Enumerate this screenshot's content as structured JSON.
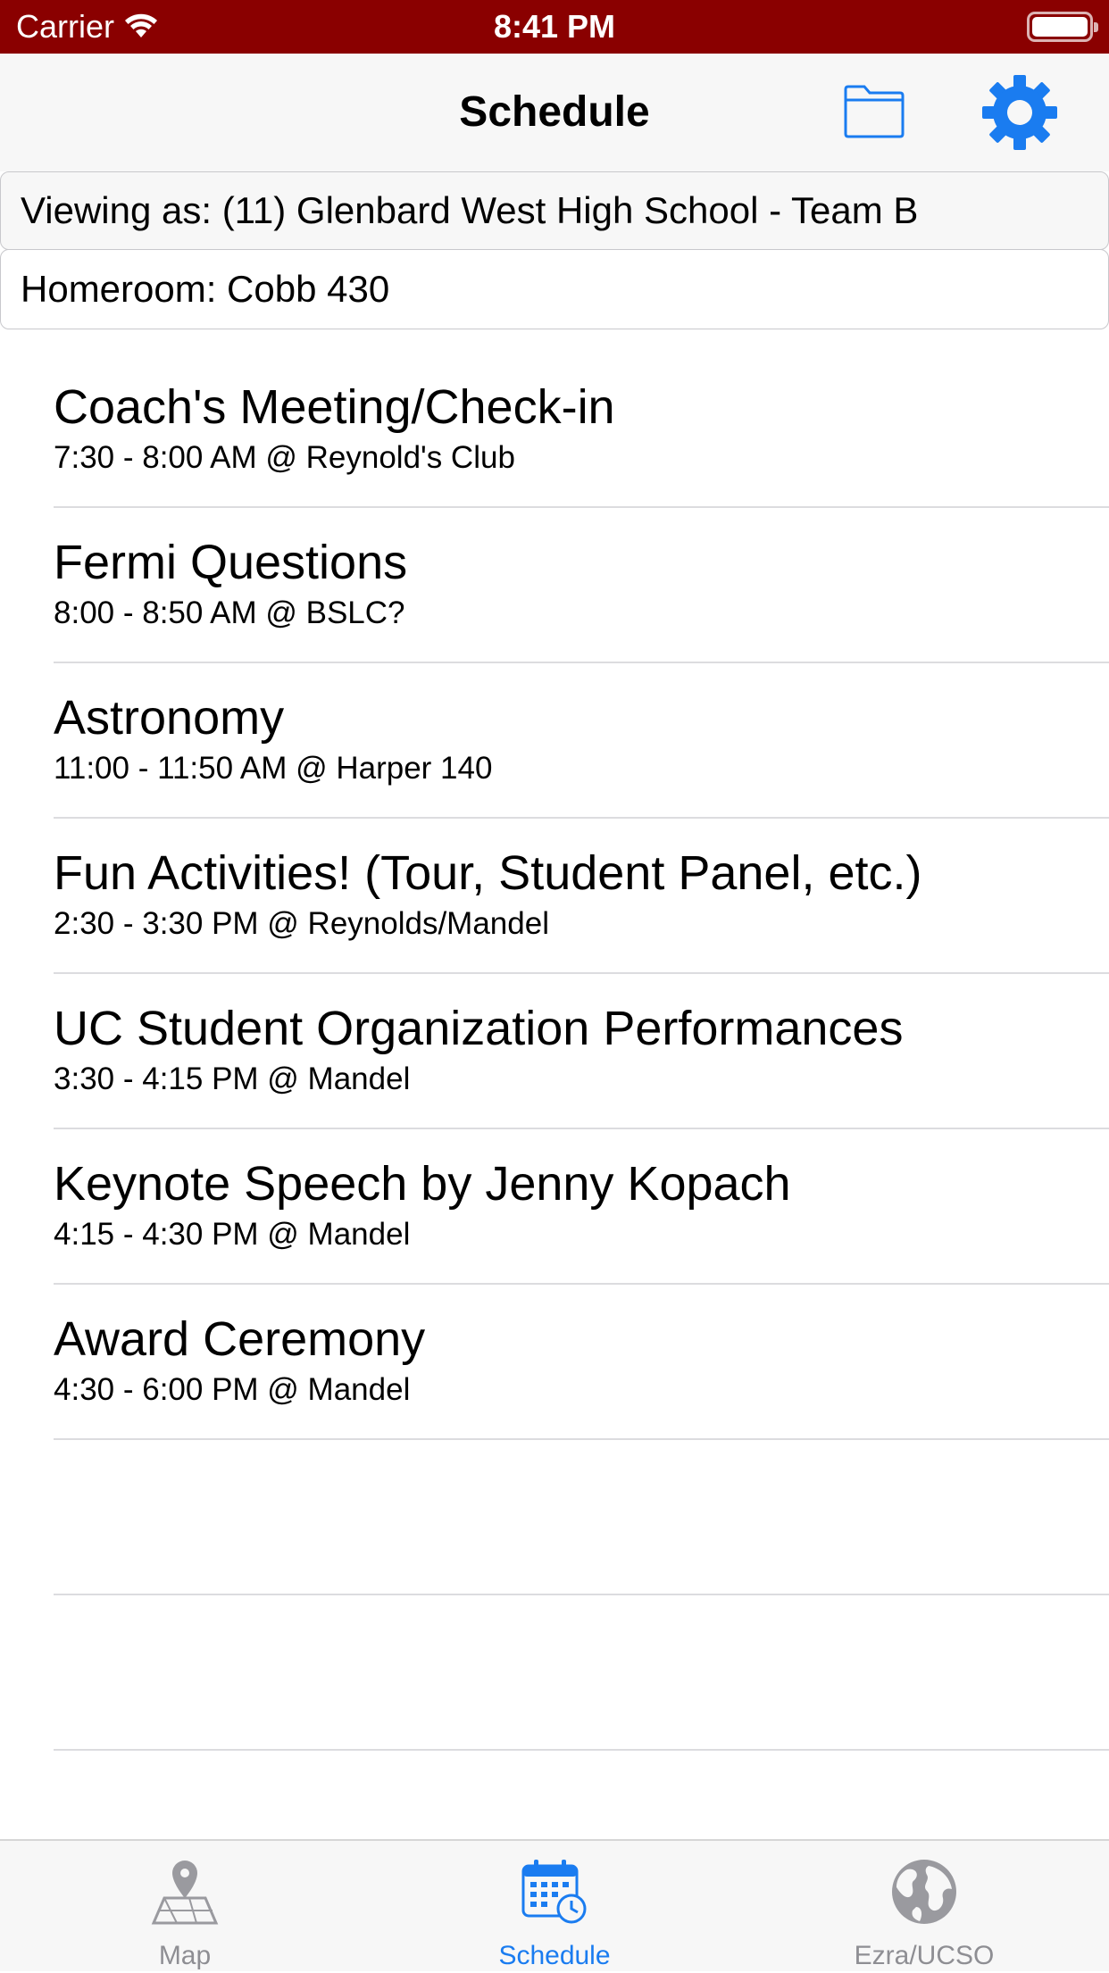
{
  "status_bar": {
    "carrier": "Carrier",
    "time": "8:41 PM",
    "icons": [
      "wifi-icon",
      "battery-icon"
    ]
  },
  "nav": {
    "title": "Schedule",
    "icons": [
      "folder-icon",
      "gear-icon"
    ],
    "accent_color": "#1a7cf0"
  },
  "viewing_as": "Viewing as: (11) Glenbard West High School - Team B",
  "homeroom": "Homeroom: Cobb 430",
  "schedule": [
    {
      "title": "Coach's Meeting/Check-in",
      "detail": "7:30 - 8:00 AM @ Reynold's Club"
    },
    {
      "title": "Fermi Questions",
      "detail": "8:00 - 8:50 AM @ BSLC?"
    },
    {
      "title": "Astronomy",
      "detail": "11:00 - 11:50 AM @ Harper 140"
    },
    {
      "title": "Fun Activities! (Tour, Student Panel, etc.)",
      "detail": "2:30 - 3:30 PM @ Reynolds/Mandel"
    },
    {
      "title": "UC Student Organization Performances",
      "detail": "3:30 - 4:15 PM @ Mandel"
    },
    {
      "title": "Keynote Speech by Jenny Kopach",
      "detail": "4:15 - 4:30 PM @ Mandel"
    },
    {
      "title": "Award Ceremony",
      "detail": "4:30 - 6:00 PM @ Mandel"
    },
    {
      "title": "",
      "detail": ""
    },
    {
      "title": "",
      "detail": ""
    }
  ],
  "tabs": [
    {
      "label": "Map",
      "icon": "map-icon",
      "active": false
    },
    {
      "label": "Schedule",
      "icon": "calendar-icon",
      "active": true
    },
    {
      "label": "Ezra/UCSO",
      "icon": "globe-icon",
      "active": false
    }
  ],
  "colors": {
    "status_bar": "#8a0000",
    "accent": "#1a7cf0",
    "inactive_tab": "#8e8e93"
  }
}
